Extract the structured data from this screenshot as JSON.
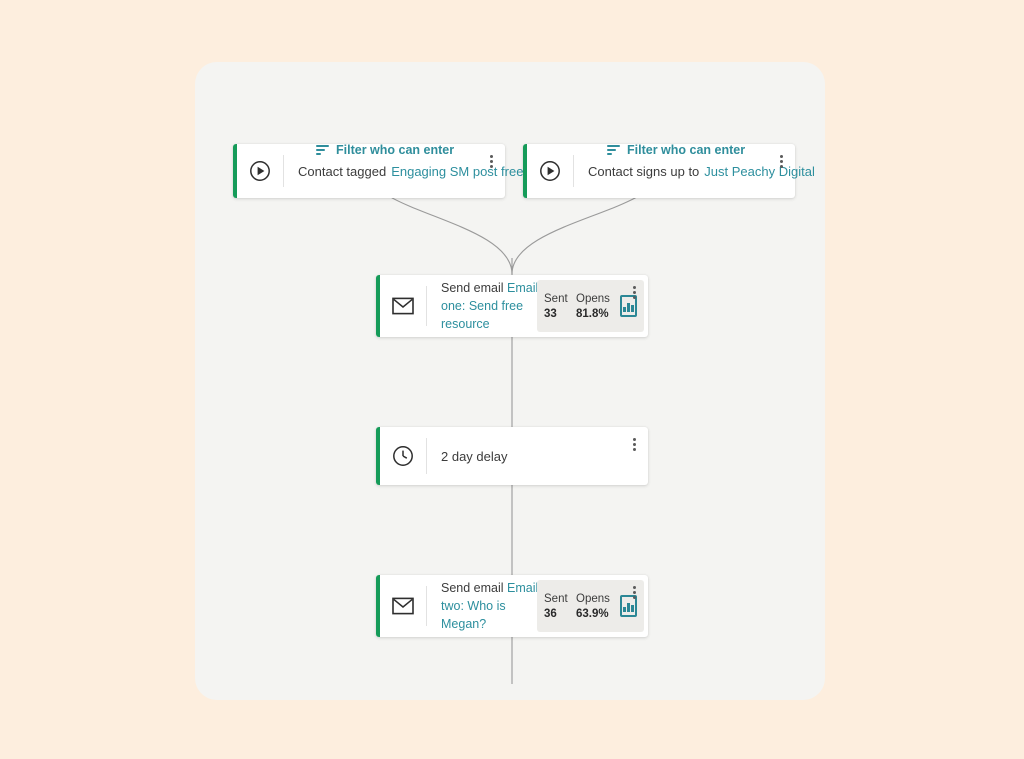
{
  "colors": {
    "page_background": "#fdeede",
    "canvas_background": "#f4f4f2",
    "node_accent_green": "#159b59",
    "link_teal": "#2d8f9e",
    "stat_panel": "#edece9",
    "connector": "#9a9a9a"
  },
  "canvas": {
    "triggers": [
      {
        "id": "trigger-1",
        "icon": "play-circle-icon",
        "label": "Contact tagged",
        "value": "Engaging SM post freebie",
        "menu_icon": "kebab-menu-icon",
        "filter_link": {
          "icon": "filter-icon",
          "label": "Filter who can enter"
        }
      },
      {
        "id": "trigger-2",
        "icon": "play-circle-icon",
        "label": "Contact signs up to",
        "value": "Just Peachy Digital",
        "menu_icon": "kebab-menu-icon",
        "filter_link": {
          "icon": "filter-icon",
          "label": "Filter who can enter"
        }
      }
    ],
    "actions": [
      {
        "id": "node-email-1",
        "type": "email",
        "icon": "envelope-icon",
        "label": "Send email",
        "email_name": "Email one:",
        "email_subject": "Send free resource",
        "menu_icon": "kebab-menu-icon",
        "stats": {
          "sent_label": "Sent",
          "sent_value": "33",
          "opens_label": "Opens",
          "opens_value": "81.8%",
          "chart_icon": "bar-chart-icon"
        }
      },
      {
        "id": "node-delay",
        "type": "delay",
        "icon": "clock-icon",
        "label": "2 day delay",
        "menu_icon": "kebab-menu-icon"
      },
      {
        "id": "node-email-2",
        "type": "email",
        "icon": "envelope-icon",
        "label": "Send email",
        "email_name": "Email two:",
        "email_subject": "Who is Megan?",
        "menu_icon": "kebab-menu-icon",
        "stats": {
          "sent_label": "Sent",
          "sent_value": "36",
          "opens_label": "Opens",
          "opens_value": "63.9%",
          "chart_icon": "bar-chart-icon"
        }
      }
    ]
  }
}
